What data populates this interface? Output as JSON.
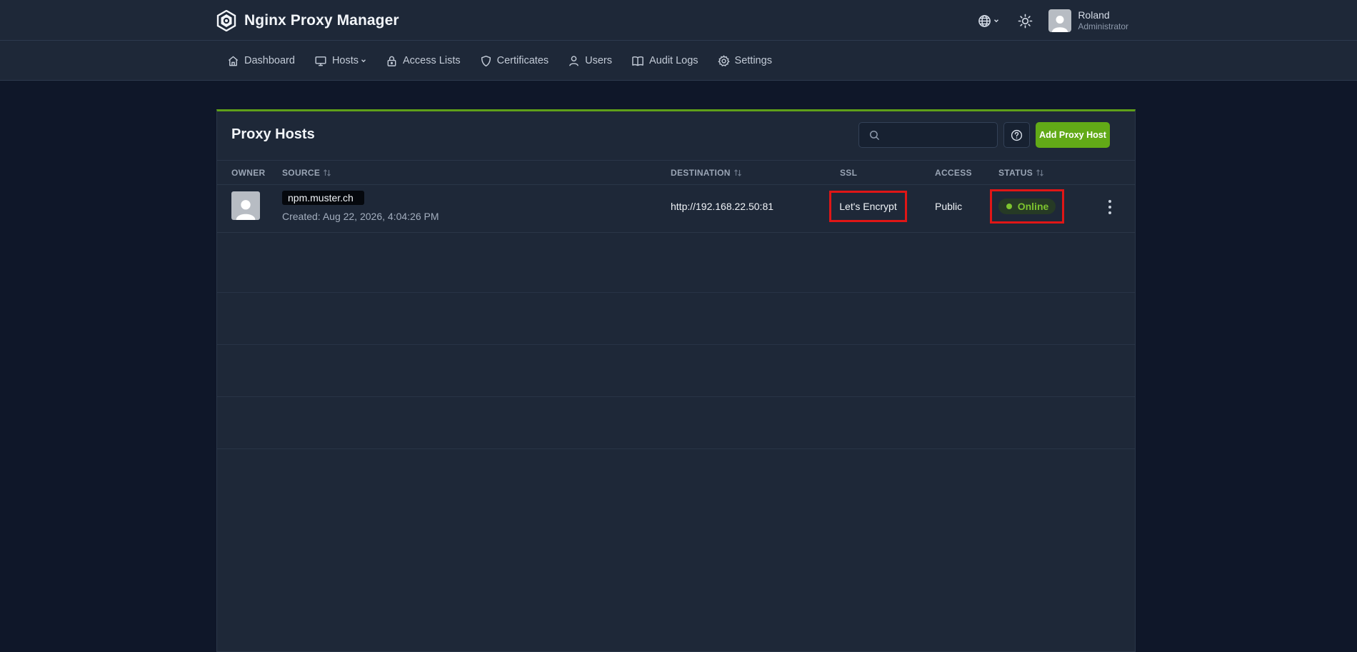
{
  "app": {
    "title": "Nginx Proxy Manager",
    "accent_color": "#62aa17",
    "highlight_color": "#e01616"
  },
  "user": {
    "name": "Roland",
    "role": "Administrator"
  },
  "nav": {
    "items": [
      {
        "label": "Dashboard",
        "icon": "home-icon"
      },
      {
        "label": "Hosts",
        "icon": "monitor-icon",
        "dropdown": true
      },
      {
        "label": "Access Lists",
        "icon": "lock-icon"
      },
      {
        "label": "Certificates",
        "icon": "shield-icon"
      },
      {
        "label": "Users",
        "icon": "user-icon"
      },
      {
        "label": "Audit Logs",
        "icon": "book-icon"
      },
      {
        "label": "Settings",
        "icon": "gear-icon"
      }
    ]
  },
  "card": {
    "title": "Proxy Hosts",
    "search_placeholder": "",
    "add_button": "Add Proxy Host"
  },
  "table": {
    "columns": {
      "owner": "OWNER",
      "source": "SOURCE",
      "destination": "DESTINATION",
      "ssl": "SSL",
      "access": "ACCESS",
      "status": "STATUS"
    },
    "rows": [
      {
        "source": "npm.muster.ch",
        "created": "Created: Aug 22, 2026, 4:04:26 PM",
        "destination": "http://192.168.22.50:81",
        "ssl": "Let's Encrypt",
        "access": "Public",
        "status": "Online"
      }
    ]
  }
}
